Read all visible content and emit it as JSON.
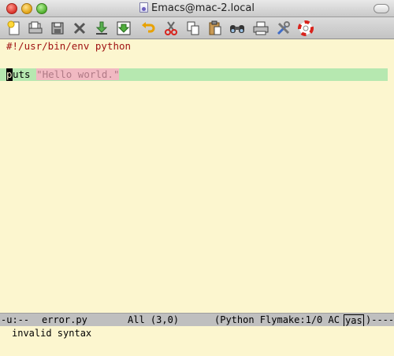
{
  "window": {
    "title": "Emacs@mac-2.local"
  },
  "toolbar": {
    "icons": [
      "new-file-icon",
      "open-file-icon",
      "save-icon",
      "close-buffer-icon",
      "download-icon",
      "save-as-icon",
      "undo-icon",
      "cut-icon",
      "copy-icon",
      "paste-icon",
      "search-icon",
      "print-icon",
      "preferences-icon",
      "help-icon"
    ]
  },
  "editor": {
    "line1": "#!/usr/bin/env python",
    "line2_cursor_char": "p",
    "line2_keyword_rest": "uts",
    "line2_string": "\"Hello world.\""
  },
  "modeline": {
    "state": "-u:--",
    "buffer": "error.py",
    "position": "All (3,0)",
    "modes": "(Python Flymake:1/0 AC",
    "yas": "yas",
    "tail": ")----"
  },
  "echo_area": {
    "message": "invalid syntax"
  },
  "colors": {
    "background": "#fcf6cf",
    "shebang": "#a01313",
    "error_line_highlight": "#b6e8b0",
    "string_highlight": "#f1b9c2",
    "modeline_bg": "#bfbfbf"
  }
}
